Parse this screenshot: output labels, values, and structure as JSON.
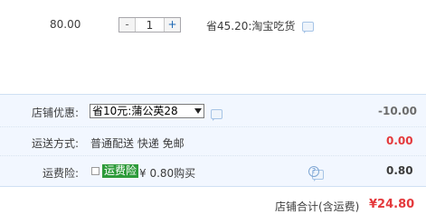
{
  "item": {
    "price": "80.00",
    "quantity": "1",
    "minus_label": "-",
    "plus_label": "+",
    "promo_text": "省45.20:淘宝吃货"
  },
  "shop_discount": {
    "label": "店铺优惠:",
    "selected": "省10元:蒲公英28",
    "value": "-10.00"
  },
  "shipping": {
    "label": "运送方式:",
    "method": "普通配送 快递 免邮",
    "value": "0.00"
  },
  "insurance": {
    "label": "运费险:",
    "name": "运费险",
    "price_text": "¥ 0.80购买",
    "help": "?",
    "value": "0.80"
  },
  "total": {
    "label": "店铺合计(含运费)",
    "value": "¥24.80"
  },
  "colors": {
    "accent_red": "#e4393c",
    "summary_bg": "#f2f7ff",
    "insurance_green": "#2d9b3a"
  },
  "icons": [
    "chat-icon",
    "dropdown-arrow-icon",
    "help-icon"
  ]
}
